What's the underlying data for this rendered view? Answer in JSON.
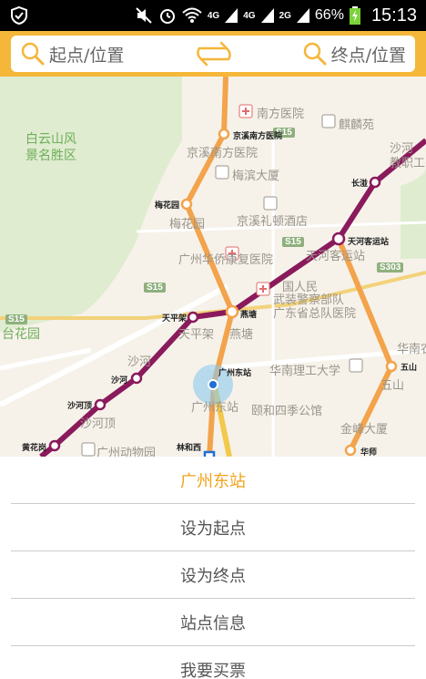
{
  "status_bar": {
    "net1": "4G",
    "net2": "4G",
    "net3": "2G",
    "battery": "66%",
    "time": "15:13"
  },
  "search": {
    "start_placeholder": "起点/位置",
    "end_placeholder": "终点/位置"
  },
  "map": {
    "place_labels": [
      "南方医院",
      "麒麟苑",
      "白云山风",
      "景名胜区",
      "京溪南方医院",
      "梅滨大厦",
      "沙河",
      "教职工",
      "梅花园",
      "京溪礼顿酒店",
      "广州华侨康复医院",
      "天河客运站",
      "国人民",
      "武装警察部队",
      "广东省总队医院",
      "天平架",
      "燕塘",
      "沙河",
      "华南理工大学",
      "华南农",
      "沙河顶",
      "五山",
      "广州东站",
      "颐和四季公馆",
      "金峰大厦",
      "广州动物园",
      "台花园"
    ],
    "road_badges": [
      "S15",
      "S15",
      "S15",
      "S15",
      "S303"
    ],
    "stations": [
      "京溪南方医院",
      "梅花园",
      "长湴",
      "天河客运站",
      "天平架",
      "燕塘",
      "沙河",
      "广州东站",
      "沙河顶",
      "五山",
      "黄花岗",
      "林和西",
      "华师"
    ],
    "line_colors": {
      "line3": "#f3a34b",
      "line6": "#8a1a5c",
      "line1": "#f2c94c"
    }
  },
  "sheet": {
    "title": "广州东站",
    "options": [
      "设为起点",
      "设为终点",
      "站点信息",
      "我要买票"
    ]
  }
}
